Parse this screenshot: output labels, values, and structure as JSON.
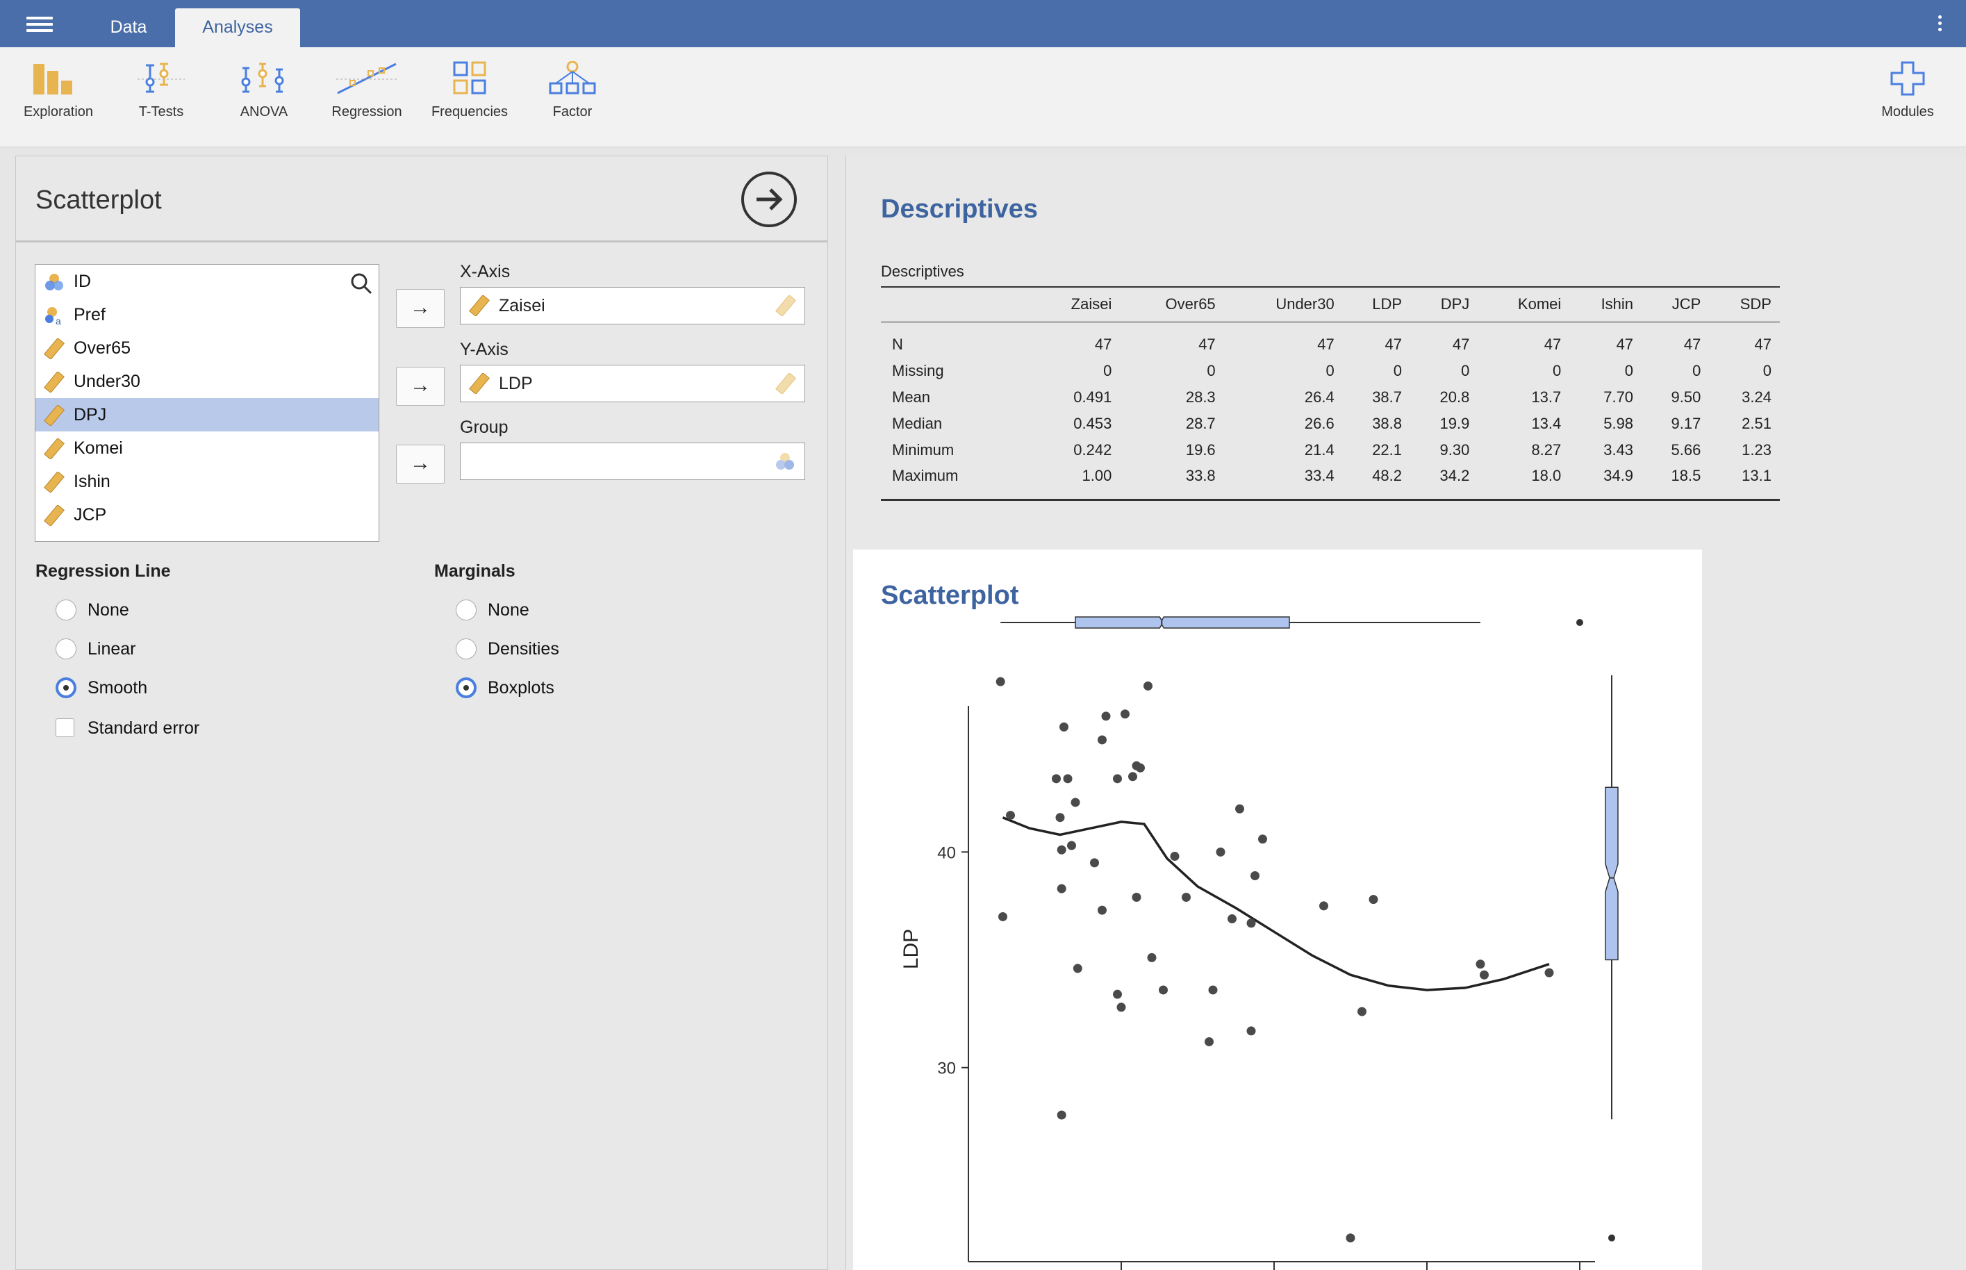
{
  "tabs": {
    "data": "Data",
    "analyses": "Analyses"
  },
  "ribbon": {
    "exploration": "Exploration",
    "ttests": "T-Tests",
    "anova": "ANOVA",
    "regression": "Regression",
    "frequencies": "Frequencies",
    "factor": "Factor",
    "modules": "Modules"
  },
  "panel": {
    "title": "Scatterplot",
    "variables": [
      "ID",
      "Pref",
      "Over65",
      "Under30",
      "DPJ",
      "Komei",
      "Ishin",
      "JCP"
    ],
    "selected_variable": "DPJ",
    "x_axis_label": "X-Axis",
    "x_axis_value": "Zaisei",
    "y_axis_label": "Y-Axis",
    "y_axis_value": "LDP",
    "group_label": "Group",
    "group_value": "",
    "regression_line": {
      "heading": "Regression Line",
      "options": [
        "None",
        "Linear",
        "Smooth"
      ],
      "selected": "Smooth",
      "standard_error": "Standard error",
      "standard_error_checked": false
    },
    "marginals": {
      "heading": "Marginals",
      "options": [
        "None",
        "Densities",
        "Boxplots"
      ],
      "selected": "Boxplots"
    }
  },
  "results": {
    "descriptives_heading": "Descriptives",
    "table_caption": "Descriptives",
    "columns": [
      "",
      "Zaisei",
      "Over65",
      "Under30",
      "LDP",
      "DPJ",
      "Komei",
      "Ishin",
      "JCP",
      "SDP"
    ],
    "rows": [
      [
        "N",
        "47",
        "47",
        "47",
        "47",
        "47",
        "47",
        "47",
        "47",
        "47"
      ],
      [
        "Missing",
        "0",
        "0",
        "0",
        "0",
        "0",
        "0",
        "0",
        "0",
        "0"
      ],
      [
        "Mean",
        "0.491",
        "28.3",
        "26.4",
        "38.7",
        "20.8",
        "13.7",
        "7.70",
        "9.50",
        "3.24"
      ],
      [
        "Median",
        "0.453",
        "28.7",
        "26.6",
        "38.8",
        "19.9",
        "13.4",
        "5.98",
        "9.17",
        "2.51"
      ],
      [
        "Minimum",
        "0.242",
        "19.6",
        "21.4",
        "22.1",
        "9.30",
        "8.27",
        "3.43",
        "5.66",
        "1.23"
      ],
      [
        "Maximum",
        "1.00",
        "33.8",
        "33.4",
        "48.2",
        "34.2",
        "18.0",
        "34.9",
        "18.5",
        "13.1"
      ]
    ],
    "scatter_heading": "Scatterplot"
  },
  "chart_data": {
    "type": "scatter",
    "title": "",
    "xlabel": "",
    "ylabel": "LDP",
    "y_ticks": [
      30,
      40
    ],
    "xlim": [
      0.2,
      1.02
    ],
    "ylim": [
      21,
      50
    ],
    "points": [
      [
        0.242,
        47.9
      ],
      [
        0.255,
        41.7
      ],
      [
        0.245,
        37.0
      ],
      [
        0.315,
        43.4
      ],
      [
        0.325,
        45.8
      ],
      [
        0.33,
        43.4
      ],
      [
        0.32,
        41.6
      ],
      [
        0.322,
        40.1
      ],
      [
        0.335,
        40.3
      ],
      [
        0.34,
        42.3
      ],
      [
        0.322,
        38.3
      ],
      [
        0.343,
        34.6
      ],
      [
        0.365,
        39.5
      ],
      [
        0.375,
        45.2
      ],
      [
        0.38,
        46.3
      ],
      [
        0.375,
        37.3
      ],
      [
        0.395,
        43.4
      ],
      [
        0.405,
        46.4
      ],
      [
        0.415,
        43.5
      ],
      [
        0.42,
        44.0
      ],
      [
        0.425,
        43.9
      ],
      [
        0.435,
        47.7
      ],
      [
        0.395,
        33.4
      ],
      [
        0.4,
        32.8
      ],
      [
        0.322,
        27.8
      ],
      [
        0.42,
        37.9
      ],
      [
        0.44,
        35.1
      ],
      [
        0.47,
        39.8
      ],
      [
        0.455,
        33.6
      ],
      [
        0.485,
        37.9
      ],
      [
        0.515,
        31.2
      ],
      [
        0.52,
        33.6
      ],
      [
        0.53,
        40.0
      ],
      [
        0.545,
        36.9
      ],
      [
        0.555,
        42.0
      ],
      [
        0.57,
        36.7
      ],
      [
        0.575,
        38.9
      ],
      [
        0.585,
        40.6
      ],
      [
        0.57,
        31.7
      ],
      [
        0.665,
        37.5
      ],
      [
        0.715,
        32.6
      ],
      [
        0.73,
        37.8
      ],
      [
        0.7,
        22.1
      ],
      [
        0.87,
        34.8
      ],
      [
        0.875,
        34.3
      ],
      [
        0.96,
        34.4
      ]
    ],
    "smooth": [
      [
        0.245,
        41.6
      ],
      [
        0.28,
        41.1
      ],
      [
        0.32,
        40.8
      ],
      [
        0.36,
        41.1
      ],
      [
        0.4,
        41.4
      ],
      [
        0.43,
        41.3
      ],
      [
        0.46,
        39.7
      ],
      [
        0.5,
        38.4
      ],
      [
        0.55,
        37.4
      ],
      [
        0.6,
        36.3
      ],
      [
        0.65,
        35.2
      ],
      [
        0.7,
        34.3
      ],
      [
        0.75,
        33.8
      ],
      [
        0.8,
        33.6
      ],
      [
        0.85,
        33.7
      ],
      [
        0.9,
        34.1
      ],
      [
        0.96,
        34.8
      ]
    ],
    "x_marginal_boxplot": {
      "whisker_low": 0.242,
      "q1": 0.34,
      "median": 0.453,
      "q3": 0.62,
      "whisker_high": 0.87,
      "outliers": [
        1.0
      ]
    },
    "y_marginal_boxplot": {
      "whisker_low": 27.6,
      "q1": 35.0,
      "median": 38.8,
      "q3": 43.0,
      "whisker_high": 48.2,
      "outliers": [
        22.1
      ]
    }
  }
}
